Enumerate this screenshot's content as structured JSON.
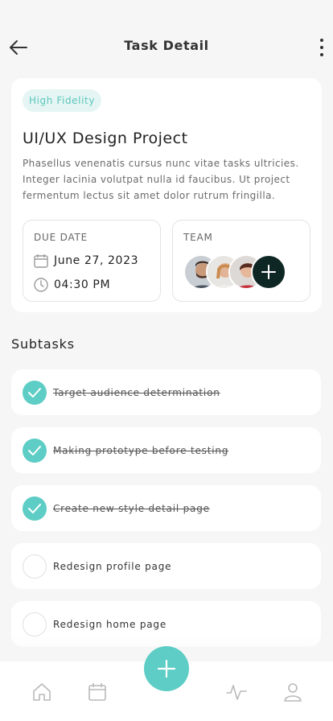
{
  "header": {
    "title": "Task Detail",
    "back_icon": "arrow-left-icon",
    "more_icon": "more-vertical-icon"
  },
  "project": {
    "tag": "High Fidelity",
    "title": "UI/UX Design Project",
    "description": "Phasellus venenatis cursus nunc vitae tasks ultricies. Integer lacinia volutpat nulla id faucibus. Ut project fermentum lectus sit amet dolor rutrum fringilla.",
    "due_label": "DUE DATE",
    "due_date": "June 27, 2023",
    "due_time": "04:30 PM",
    "team_label": "TEAM"
  },
  "subtasks": {
    "heading": "Subtasks",
    "items": [
      {
        "label": "Target audience determination",
        "done": true
      },
      {
        "label": "Making prototype before testing",
        "done": true
      },
      {
        "label": "Create new style detail page",
        "done": true
      },
      {
        "label": "Redesign profile page",
        "done": false
      },
      {
        "label": "Redesign home page",
        "done": false
      }
    ]
  },
  "tabbar": {
    "items": [
      "home-icon",
      "calendar-icon",
      "activity-icon",
      "profile-icon"
    ],
    "fab_icon": "plus-icon"
  },
  "colors": {
    "accent": "#5ecdc5",
    "dark": "#0f2724",
    "chip_bg": "#e4f5f3"
  }
}
